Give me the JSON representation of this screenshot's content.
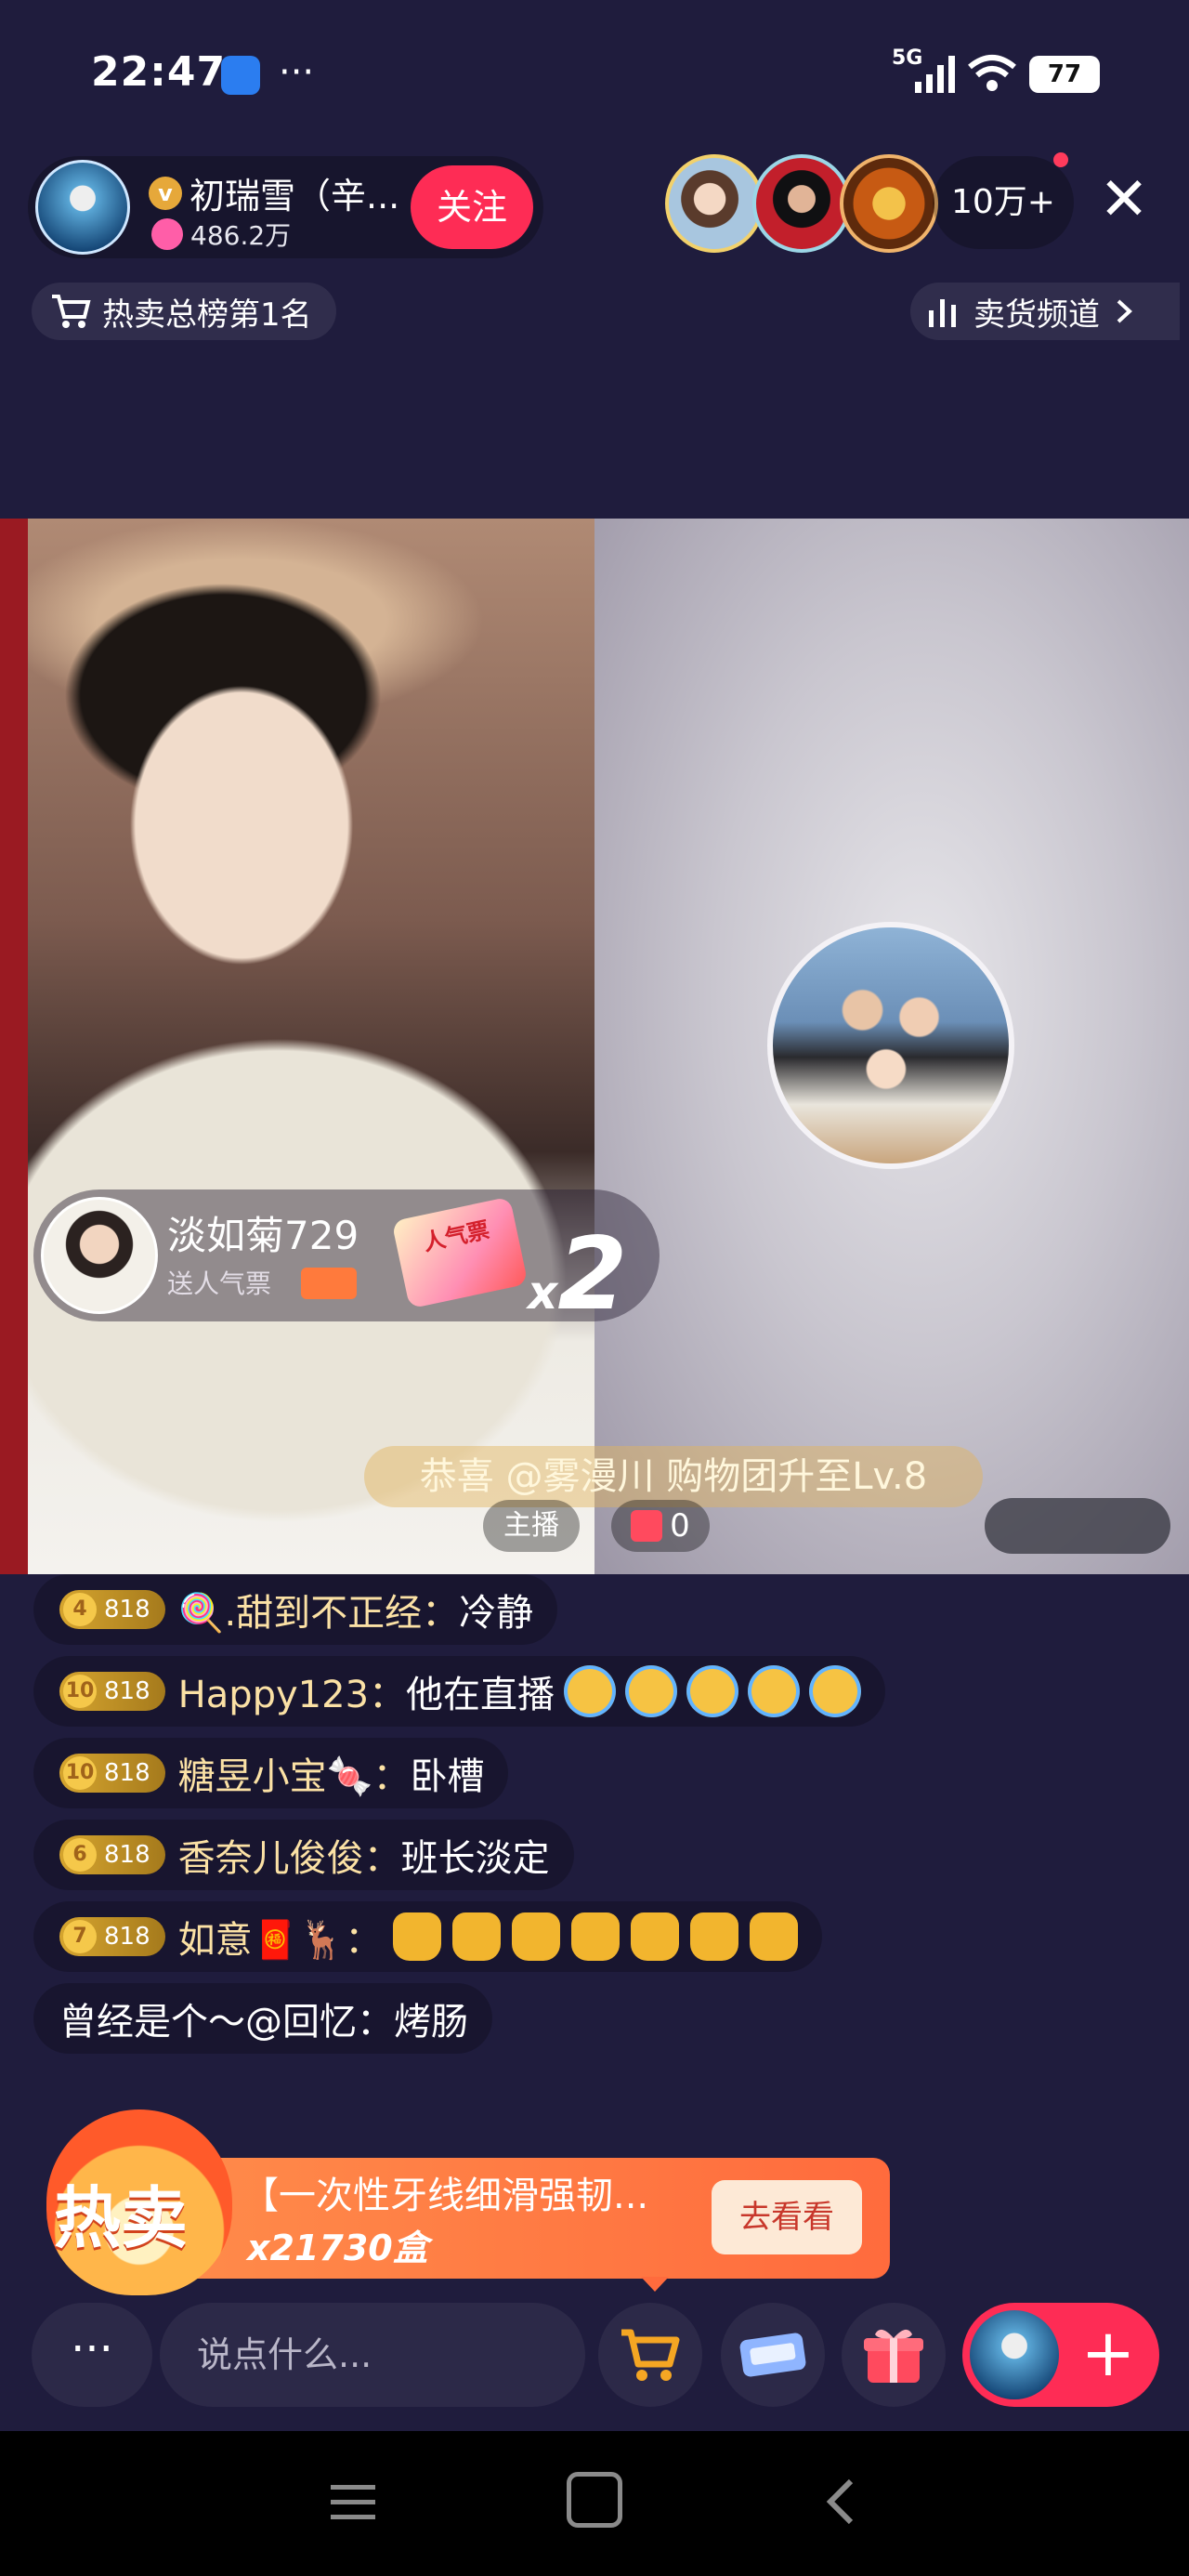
{
  "status_bar": {
    "time": "22:47",
    "more": "···",
    "network": "5G",
    "battery": "77"
  },
  "host": {
    "name": "初瑞雪（辛...",
    "verified_badge": "v",
    "likes": "486.2万",
    "follow_label": "关注"
  },
  "viewers": {
    "count_label": "10万+"
  },
  "close_label": "✕",
  "rank": {
    "label": "热卖总榜第1名"
  },
  "channel": {
    "label": "卖货频道"
  },
  "gift_banner": {
    "user": "淡如菊729",
    "action": "送人气票",
    "ticket_label": "人气票",
    "multiplier_x": "x",
    "multiplier": "2"
  },
  "congrats": "恭喜 @雾漫川 购物团升至Lv.8",
  "stage": {
    "host_tag": "主播",
    "gift_count": "0"
  },
  "chat": [
    {
      "level": "4",
      "badge": "818",
      "user": "🍭.甜到不正经：",
      "message": "冷静",
      "emoji": []
    },
    {
      "level": "10",
      "badge": "818",
      "user": "Happy123：",
      "message": "他在直播",
      "emoji": [
        "cry",
        "cry",
        "cry",
        "cry",
        "cry"
      ]
    },
    {
      "level": "10",
      "badge": "818",
      "user": "糖昱小宝🍬：",
      "message": "卧槽",
      "emoji": []
    },
    {
      "level": "6",
      "badge": "818",
      "user": "香奈儿俊俊：",
      "message": "班长淡定",
      "emoji": []
    },
    {
      "level": "7",
      "badge": "818",
      "user": "如意🧧🦌：",
      "message": "",
      "emoji": [
        "thumb",
        "thumb",
        "thumb",
        "thumb",
        "thumb",
        "thumb",
        "thumb"
      ]
    },
    {
      "level": "",
      "badge": "",
      "user": "曾经是个～@回忆：",
      "message": "烤肠",
      "emoji": []
    }
  ],
  "hot_sale": {
    "label": "热卖",
    "title": "【一次性牙线细滑强韧...",
    "quantity": "x21730盒",
    "cta": "去看看"
  },
  "toolbar": {
    "more": "···",
    "input_placeholder": "说点什么...",
    "plus": "+"
  },
  "colors": {
    "accent": "#fe2c55",
    "background": "#1f1c3d",
    "level_gold": "#d6a52f"
  }
}
